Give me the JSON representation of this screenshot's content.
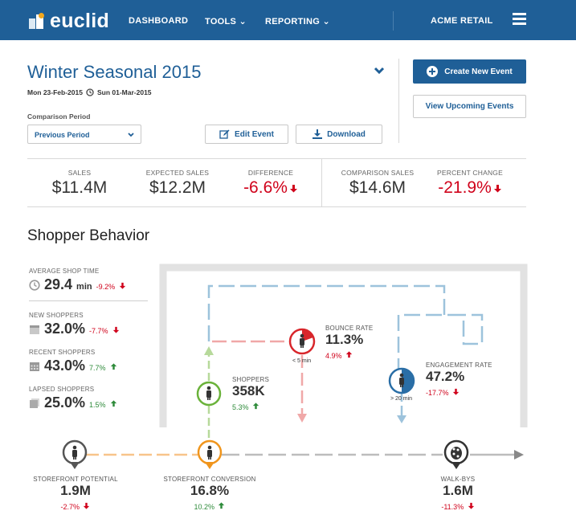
{
  "nav": {
    "logo_text": "euclid",
    "items": [
      {
        "label": "DASHBOARD"
      },
      {
        "label": "TOOLS ⌄"
      },
      {
        "label": "REPORTING ⌄"
      }
    ],
    "account": "ACME RETAIL",
    "menu_icon": "hamburger-icon",
    "brand_color": "#1f5f97"
  },
  "event": {
    "title": "Winter Seasonal 2015",
    "start_date": "Mon 23-Feb-2015",
    "end_date": "Sun 01-Mar-2015",
    "comparison_label": "Comparison Period",
    "comparison_value": "Previous Period",
    "edit_label": "Edit Event",
    "download_label": "Download",
    "create_label": "Create New Event",
    "upcoming_label": "View Upcoming Events"
  },
  "metrics": [
    {
      "label": "SALES",
      "value": "$11.4M"
    },
    {
      "label": "EXPECTED SALES",
      "value": "$12.2M"
    },
    {
      "label": "DIFFERENCE",
      "value": "-6.6%"
    },
    {
      "label": "COMPARISON SALES",
      "value": "$14.6M"
    },
    {
      "label": "PERCENT CHANGE",
      "value": "-21.9%"
    }
  ],
  "behavior": {
    "title": "Shopper Behavior",
    "avg_shop_time": {
      "label": "AVERAGE SHOP TIME",
      "value": "29.4",
      "unit": "min",
      "change": "-9.2%"
    },
    "new_shoppers": {
      "label": "NEW SHOPPERS",
      "value": "32.0%",
      "change": "-7.7%"
    },
    "recent_shoppers": {
      "label": "RECENT SHOPPERS",
      "value": "43.0%",
      "change": "7.7%"
    },
    "lapsed_shoppers": {
      "label": "LAPSED SHOPPERS",
      "value": "25.0%",
      "change": "1.5%"
    },
    "bounce_rate": {
      "label": "BOUNCE RATE",
      "value": "11.3%",
      "change": "4.9%",
      "threshold": "< 5 min"
    },
    "shoppers": {
      "label": "SHOPPERS",
      "value": "358K",
      "change": "5.3%"
    },
    "engagement_rate": {
      "label": "ENGAGEMENT RATE",
      "value": "47.2%",
      "change": "-17.7%",
      "threshold": "> 20 min"
    },
    "storefront_potential": {
      "label": "STOREFRONT POTENTIAL",
      "value": "1.9M",
      "change": "-2.7%"
    },
    "storefront_conversion": {
      "label": "STOREFRONT CONVERSION",
      "value": "16.8%",
      "change": "10.2%"
    },
    "walk_bys": {
      "label": "WALK-BYS",
      "value": "1.6M",
      "change": "-11.3%"
    },
    "colors": {
      "negative": "#d0021b",
      "positive": "#2e8b3a",
      "orange": "#f0951c",
      "green": "#6ab23a",
      "red": "#d8262b",
      "blue": "#2a6ea6",
      "path_blue": "#9dc3dc",
      "path_red": "#f0a8a8",
      "path_orange": "#f7c48a",
      "path_green": "#b7d99b"
    }
  }
}
